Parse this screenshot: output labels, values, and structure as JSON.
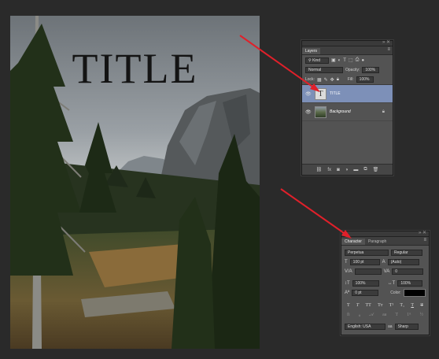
{
  "document": {
    "title_text": "TITLE"
  },
  "layers_panel": {
    "header_label": "Layers",
    "kind_filter": "Kind",
    "blend_mode": "Normal",
    "opacity_label": "Opacity:",
    "opacity_value": "100%",
    "lock_label": "Lock:",
    "fill_label": "Fill:",
    "fill_value": "100%",
    "layers": [
      {
        "name": "TITLE",
        "type": "text",
        "selected": true
      },
      {
        "name": "Background",
        "type": "image",
        "selected": false
      }
    ]
  },
  "character_panel": {
    "tabs": [
      {
        "label": "Character",
        "active": true
      },
      {
        "label": "Paragraph",
        "active": false
      }
    ],
    "font_family": "Perpetua",
    "font_style": "Regular",
    "font_size": "100 pt",
    "leading": "(Auto)",
    "kerning": "",
    "tracking": "0",
    "vertical_scale": "100%",
    "horizontal_scale": "100%",
    "baseline_shift": "0 pt",
    "color_label": "Color:",
    "color_value": "#000000",
    "language": "English: USA",
    "antialias_label": "aa",
    "antialias": "Sharp"
  },
  "colors": {
    "arrow": "#e0202a",
    "selection": "#7d90b8"
  }
}
